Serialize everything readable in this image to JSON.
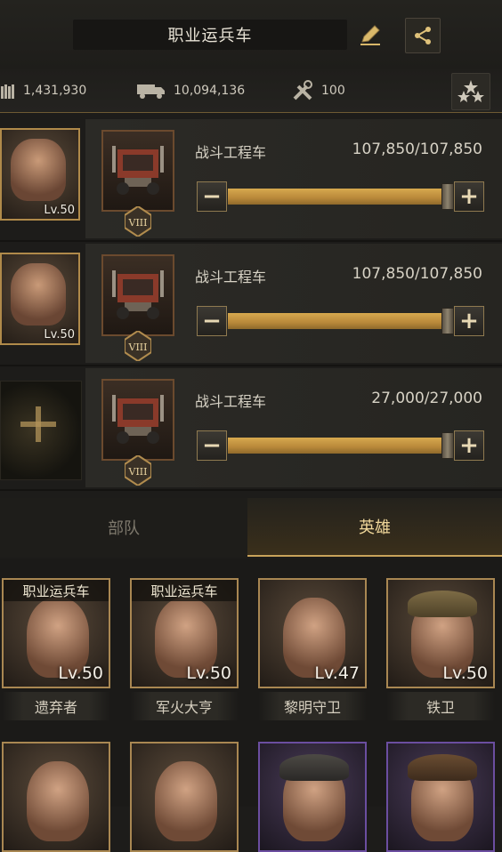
{
  "header": {
    "title": "职业运兵车",
    "edit_icon": "pencil-icon",
    "share_icon": "share-icon"
  },
  "stats": {
    "troops": "1,431,930",
    "load": "10,094,136",
    "repair": "100",
    "troops_icon": "ammo-icon",
    "load_icon": "truck-icon",
    "repair_icon": "wrench-icon",
    "rank_icon": "stars-icon"
  },
  "squads": [
    {
      "hero_level": "Lv.50",
      "unit_name": "战斗工程车",
      "count": "107,850/107,850",
      "rank": "VIII",
      "fill": 1.0
    },
    {
      "hero_level": "Lv.50",
      "unit_name": "战斗工程车",
      "count": "107,850/107,850",
      "rank": "VIII",
      "fill": 1.0
    },
    {
      "hero_level": "",
      "unit_name": "战斗工程车",
      "count": "27,000/27,000",
      "rank": "VIII",
      "fill": 1.0
    }
  ],
  "controls": {
    "minus": "−",
    "plus": "+"
  },
  "tabs": {
    "troops": "部队",
    "heroes": "英雄",
    "active": "heroes"
  },
  "heroes": [
    {
      "tag": "职业运兵车",
      "level": "Lv.50",
      "name": "遗弃者"
    },
    {
      "tag": "职业运兵车",
      "level": "Lv.50",
      "name": "军火大亨"
    },
    {
      "tag": "",
      "level": "Lv.47",
      "name": "黎明守卫"
    },
    {
      "tag": "",
      "level": "Lv.50",
      "name": "铁卫"
    }
  ],
  "colors": {
    "accent_gold": "#c9a35a",
    "slider_fill": "#d0a14a",
    "purple_frame": "#6b4ea0"
  }
}
